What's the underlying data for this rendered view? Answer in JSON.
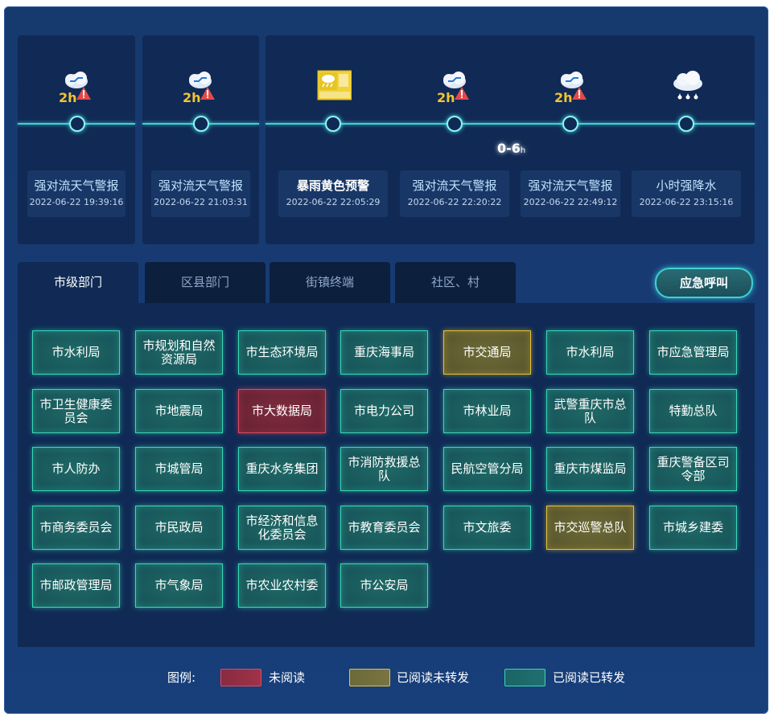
{
  "timeline": {
    "events": [
      {
        "title": "强对流天气警报",
        "date": "2022-06-22 19:39:16",
        "icon": "convection-warning-icon",
        "icon_label": "2h"
      },
      {
        "title": "强对流天气警报",
        "date": "2022-06-22 21:03:31",
        "icon": "convection-warning-icon",
        "icon_label": "2h"
      },
      {
        "title": "暴雨黄色预警",
        "date": "2022-06-22 22:05:29",
        "icon": "rainstorm-yellow-warning-icon",
        "icon_label": ""
      },
      {
        "title": "强对流天气警报",
        "date": "2022-06-22 22:20:22",
        "icon": "convection-warning-icon",
        "icon_label": "2h"
      },
      {
        "title": "强对流天气警报",
        "date": "2022-06-22 22:49:12",
        "icon": "convection-warning-icon",
        "icon_label": "2h"
      },
      {
        "title": "小时强降水",
        "date": "2022-06-22 23:15:16",
        "icon": "heavy-rain-icon",
        "icon_label": ""
      }
    ],
    "range_label": "0-6",
    "range_unit": "h"
  },
  "tabs": [
    {
      "label": "市级部门",
      "active": true
    },
    {
      "label": "区县部门",
      "active": false
    },
    {
      "label": "街镇终端",
      "active": false
    },
    {
      "label": "社区、村",
      "active": false
    }
  ],
  "emergency_call_label": "应急呼叫",
  "departments": [
    {
      "name": "市水利局",
      "status": "read-forwarded"
    },
    {
      "name": "市规划和自然资源局",
      "status": "read-forwarded"
    },
    {
      "name": "市生态环境局",
      "status": "read-forwarded"
    },
    {
      "name": "重庆海事局",
      "status": "read-forwarded"
    },
    {
      "name": "市交通局",
      "status": "read-not-forwarded"
    },
    {
      "name": "市水利局",
      "status": "read-forwarded"
    },
    {
      "name": "市应急管理局",
      "status": "read-forwarded"
    },
    {
      "name": "市卫生健康委员会",
      "status": "read-forwarded"
    },
    {
      "name": "市地震局",
      "status": "read-forwarded"
    },
    {
      "name": "市大数据局",
      "status": "unread"
    },
    {
      "name": "市电力公司",
      "status": "read-forwarded"
    },
    {
      "name": "市林业局",
      "status": "read-forwarded"
    },
    {
      "name": "武警重庆市总队",
      "status": "read-forwarded"
    },
    {
      "name": "特勤总队",
      "status": "read-forwarded"
    },
    {
      "name": "市人防办",
      "status": "read-forwarded"
    },
    {
      "name": "市城管局",
      "status": "read-forwarded"
    },
    {
      "name": "重庆水务集团",
      "status": "read-forwarded"
    },
    {
      "name": "市消防救援总队",
      "status": "read-forwarded"
    },
    {
      "name": "民航空管分局",
      "status": "read-forwarded"
    },
    {
      "name": "重庆市煤监局",
      "status": "read-forwarded"
    },
    {
      "name": "重庆警备区司令部",
      "status": "read-forwarded"
    },
    {
      "name": "市商务委员会",
      "status": "read-forwarded"
    },
    {
      "name": "市民政局",
      "status": "read-forwarded"
    },
    {
      "name": "市经济和信息化委员会",
      "status": "read-forwarded"
    },
    {
      "name": "市教育委员会",
      "status": "read-forwarded"
    },
    {
      "name": "市文旅委",
      "status": "read-forwarded"
    },
    {
      "name": "市交巡警总队",
      "status": "read-not-forwarded"
    },
    {
      "name": "市城乡建委",
      "status": "read-forwarded"
    },
    {
      "name": "市邮政管理局",
      "status": "read-forwarded"
    },
    {
      "name": "市气象局",
      "status": "read-forwarded"
    },
    {
      "name": "市农业农村委",
      "status": "read-forwarded"
    },
    {
      "name": "市公安局",
      "status": "read-forwarded"
    }
  ],
  "legend": {
    "title": "图例:",
    "items": [
      {
        "label": "未阅读",
        "color": "#8a2a40"
      },
      {
        "label": "已阅读未转发",
        "color": "#6b6a3a"
      },
      {
        "label": "已阅读已转发",
        "color": "#1b6464"
      }
    ]
  },
  "colors": {
    "accent": "#3fd1d6",
    "unread": "#e04a60",
    "read_not_forwarded": "#e3c23c",
    "read_forwarded": "#38d9b4"
  }
}
